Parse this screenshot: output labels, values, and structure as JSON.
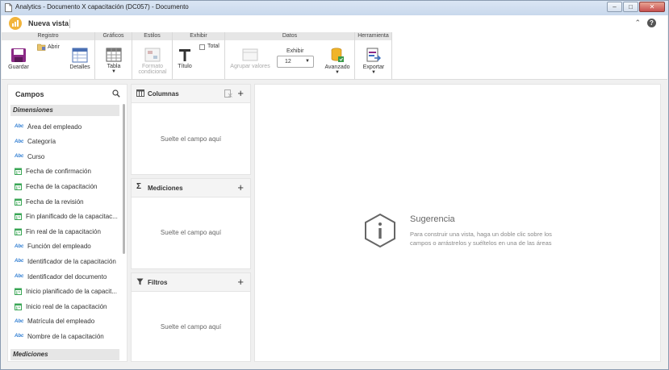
{
  "window": {
    "title": "Analytics - Documento X capacitación (DC057) - Documento",
    "buttons": {
      "minimize": "–",
      "maximize": "□",
      "close": "✕"
    }
  },
  "appbar": {
    "view_name": "Nueva vista",
    "collapse": "⌃",
    "help": "?"
  },
  "ribbon": {
    "groups": {
      "registro": "Registro",
      "graficos": "Gráficos",
      "estilos": "Estilos",
      "exhibir": "Exhibir",
      "datos": "Datos",
      "herramienta": "Herramienta"
    },
    "buttons": {
      "guardar": "Guardar",
      "abrir": "Abrir",
      "detalles": "Detalles",
      "tabla": "Tabla",
      "formato_line1": "Formato",
      "formato_line2": "condicional",
      "titulo": "Título",
      "total": "Total",
      "agrupar": "Agrupar valores",
      "exhibir_label": "Exhibir",
      "exhibir_value": "12",
      "avanzado": "Avanzado",
      "exportar": "Exportar"
    }
  },
  "sidebar": {
    "title": "Campos",
    "dimensions_header": "Dimensiones",
    "measures_header": "Mediciones",
    "fields": [
      {
        "label": "Área del empleado",
        "type": "text"
      },
      {
        "label": "Categoría",
        "type": "text"
      },
      {
        "label": "Curso",
        "type": "text"
      },
      {
        "label": "Fecha de confirmación",
        "type": "date"
      },
      {
        "label": "Fecha de la capacitación",
        "type": "date"
      },
      {
        "label": "Fecha de la revisión",
        "type": "date"
      },
      {
        "label": "Fin planificado de la capacitac...",
        "type": "date"
      },
      {
        "label": "Fin real de la capacitación",
        "type": "date"
      },
      {
        "label": "Función del empleado",
        "type": "text"
      },
      {
        "label": "Identificador de la capacitación",
        "type": "text"
      },
      {
        "label": "Identificador del documento",
        "type": "text"
      },
      {
        "label": "Inicio planificado de la capacit...",
        "type": "date"
      },
      {
        "label": "Inicio real de la capacitación",
        "type": "date"
      },
      {
        "label": "Matrícula del empleado",
        "type": "text"
      },
      {
        "label": "Nombre de la capacitación",
        "type": "text"
      }
    ],
    "text_icon": "Abc"
  },
  "panels": {
    "columnas": {
      "title": "Columnas",
      "drop": "Suelte el campo aquí"
    },
    "mediciones": {
      "title": "Mediciones",
      "drop": "Suelte el campo aquí"
    },
    "filtros": {
      "title": "Filtros",
      "drop": "Suelte el campo aquí"
    },
    "plus": "+"
  },
  "tip": {
    "title": "Sugerencia",
    "text": "Para construir una vista, haga un doble clic sobre los campos o arrástrelos y suéltelos en una de las áreas"
  },
  "colors": {
    "accent_logo": "#f2b43b",
    "text_icon": "#2b7bd1",
    "date_icon": "#3aa655"
  }
}
